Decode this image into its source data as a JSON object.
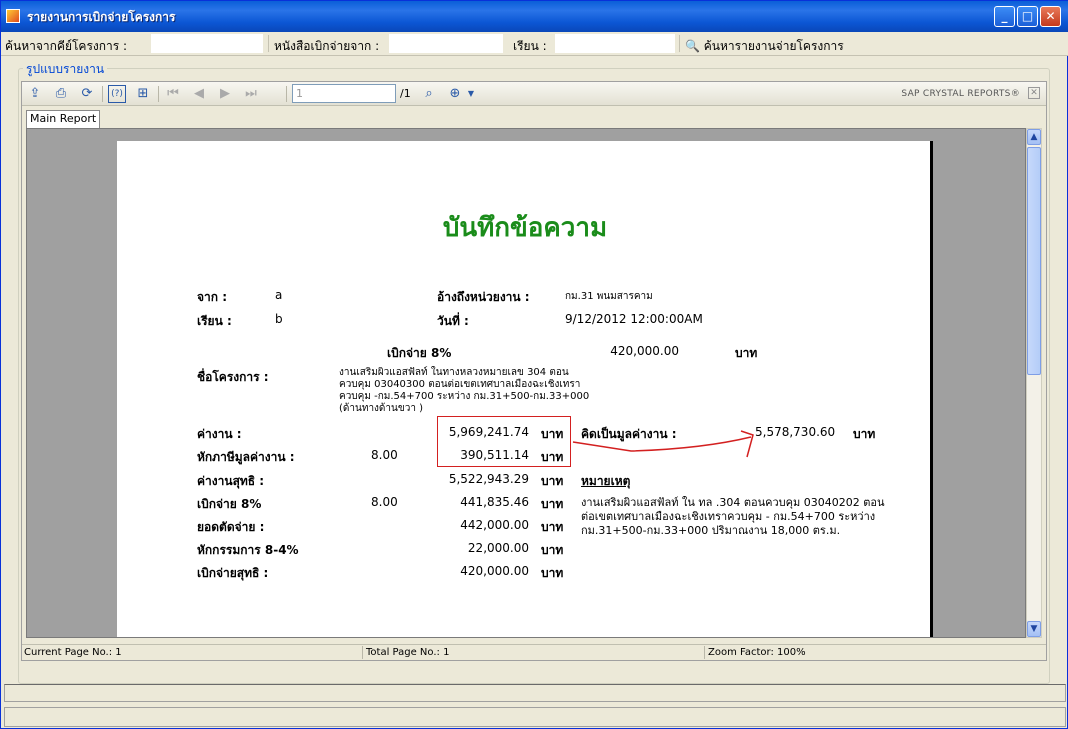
{
  "window": {
    "title": "รายงานการเบิกจ่ายโครงการ"
  },
  "searchbar": {
    "key_label": "ค้นหาจากคีย์โครงการ :",
    "letter_label": "หนังสือเบิกจ่ายจาก :",
    "to_label": "เรียน :",
    "search_button": "ค้นหารายงานจ่ายโครงการ"
  },
  "group": {
    "title": "รูปแบบรายงาน"
  },
  "toolbar": {
    "page_input": "1",
    "page_total": "/1",
    "brand": "SAP CRYSTAL REPORTS®"
  },
  "tab": {
    "label": "Main Report"
  },
  "report": {
    "title": "บันทึกข้อความ",
    "from_label": "จาก :",
    "from_value": "a",
    "to_label": "เรียน :",
    "to_value": "b",
    "ref_label": "อ้างถึงหน่วยงาน :",
    "ref_value": "กม.31 พนมสารคาม",
    "date_label": "วันที่ :",
    "date_value": "9/12/2012  12:00:00AM",
    "disburse_label": "เบิกจ่าย 8%",
    "disburse_value": "420,000.00",
    "baht": "บาท",
    "project_label": "ชื่อโครงการ :",
    "project_text": "งานเสริมผิวแอสฟัลท์ ในทางหลวงหมายเลข 304 ตอนควบคุม 03040300 ตอนต่อเขตเทศบาลเมืองฉะเชิงเทราควบคุม  -กม.54+700 ระหว่าง กม.31+500-กม.33+000 (ด้านทางด้านขวา )",
    "work_cost_label": "ค่างาน :",
    "work_cost_value": "5,969,241.74",
    "deduct_label": "หักภาษีมูลค่างาน :",
    "deduct_rate": "8.00",
    "deduct_value": "390,511.14",
    "calc_label": "คิดเป็นมูลค่างาน :",
    "calc_value": "5,578,730.60",
    "net_label": "ค่างานสุทธิ :",
    "net_value": "5,522,943.29",
    "note_label": "หมายเหตุ",
    "disb8_label": "เบิกจ่าย 8%",
    "disb8_rate": "8.00",
    "disb8_value": "441,835.46",
    "round_label": "ยอดตัดจ่าย :",
    "round_value": "442,000.00",
    "committee_label": "หักกรรมการ 8-4%",
    "committee_value": "22,000.00",
    "netpay_label": "เบิกจ่ายสุทธิ :",
    "netpay_value": "420,000.00",
    "note_text": "งานเสริมผิวแอสฟัลท์ ใน ทล .304 ตอนควบคุม 03040202 ตอนต่อเขตเทศบาลเมืองฉะเชิงเทราควบคุม - กม.54+700 ระหว่าง กม.31+500-กม.33+000 ปริมาณงาน 18,000 ตร.ม."
  },
  "status": {
    "current_page": "Current Page No.: 1",
    "total_page": "Total Page No.: 1",
    "zoom": "Zoom Factor: 100%"
  }
}
